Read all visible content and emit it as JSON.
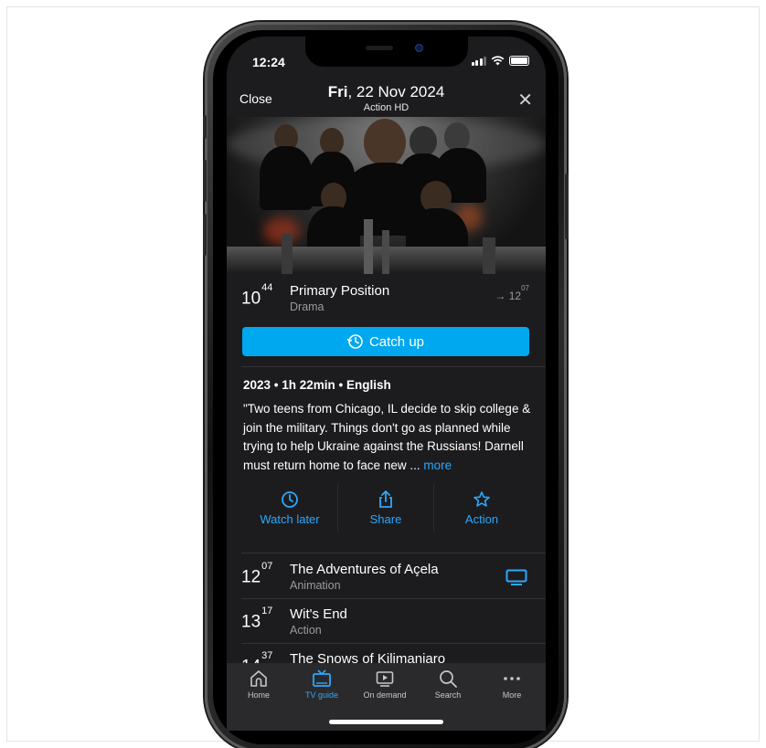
{
  "status": {
    "time": "12:24"
  },
  "header": {
    "close_label": "Close",
    "date_day": "Fri",
    "date_rest": ", 22 Nov 2024",
    "channel": "Action HD"
  },
  "current": {
    "start_hour": "10",
    "start_min": "44",
    "title": "Primary Position",
    "genre": "Drama",
    "end_prefix": "→ ",
    "end_hour": "12",
    "end_min": "07"
  },
  "catchup_label": "Catch up",
  "meta": "2023 • 1h 22min • English",
  "description": "\"Two teens from Chicago, IL decide to skip college & join the military. Things don't go as planned while trying to help Ukraine against the Russians! Darnell must return home to face new ...",
  "more_label": "more",
  "actions": [
    {
      "label": "Watch later",
      "icon": "clock-icon"
    },
    {
      "label": "Share",
      "icon": "share-icon"
    },
    {
      "label": "Action",
      "icon": "star-icon"
    }
  ],
  "schedule": [
    {
      "hour": "12",
      "min": "07",
      "title": "The Adventures of Açela",
      "genre": "Animation",
      "icon": "tv-icon"
    },
    {
      "hour": "13",
      "min": "17",
      "title": "Wit's End",
      "genre": "Action"
    },
    {
      "hour": "14",
      "min": "37",
      "title": "The Snows of Kilimanjaro",
      "genre": ""
    }
  ],
  "nav": [
    {
      "label": "Home",
      "icon": "home-icon"
    },
    {
      "label": "TV guide",
      "icon": "tv-guide-icon",
      "active": true
    },
    {
      "label": "On demand",
      "icon": "play-icon"
    },
    {
      "label": "Search",
      "icon": "search-icon"
    },
    {
      "label": "More",
      "icon": "more-icon"
    }
  ],
  "colors": {
    "accent": "#00a8f0",
    "link": "#2ba8ff",
    "background": "#1c1c1e"
  }
}
